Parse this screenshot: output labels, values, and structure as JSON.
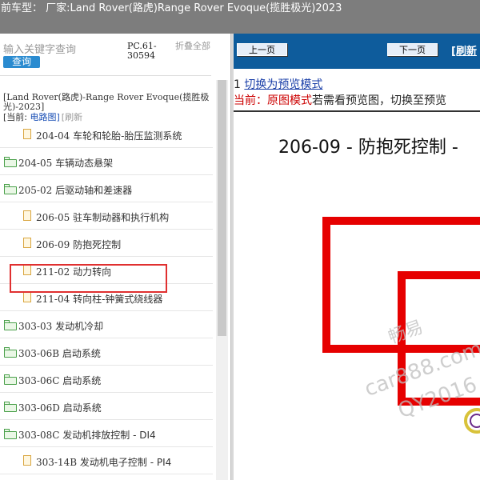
{
  "titlebar": {
    "text": "前车型： 厂家:Land Rover(路虎)Range Rover Evoque(揽胜极光)2023"
  },
  "sidebar": {
    "search_placeholder": "输入关键字查询",
    "query_button": "查询",
    "pc_code": "PC.61-30594",
    "collapse_all": "折叠全部",
    "vehicle_title": "[Land Rover(路虎)-Range Rover Evoque(揽胜极光)-2023]",
    "current_prefix": "[当前: ",
    "current_value": "电路图]",
    "refresh": "[刷新",
    "items": [
      {
        "code": "204-04",
        "label": "车轮和轮胎-胎压监测系统",
        "icon": "file-icon"
      },
      {
        "code": "204-05",
        "label": "车辆动态悬架",
        "icon": "folder-icon"
      },
      {
        "code": "205-02",
        "label": "后驱动轴和差速器",
        "icon": "folder-icon"
      },
      {
        "code": "206-05",
        "label": "驻车制动器和执行机构",
        "icon": "file-icon"
      },
      {
        "code": "206-09",
        "label": "防抱死控制",
        "icon": "file-icon"
      },
      {
        "code": "211-02",
        "label": "动力转向",
        "icon": "file-icon"
      },
      {
        "code": "211-04",
        "label": "转向柱-钟簧式绕线器",
        "icon": "file-icon"
      },
      {
        "code": "303-03",
        "label": "发动机冷却",
        "icon": "folder-icon"
      },
      {
        "code": "303-06B",
        "label": "启动系统",
        "icon": "folder-icon"
      },
      {
        "code": "303-06C",
        "label": "启动系统",
        "icon": "folder-icon"
      },
      {
        "code": "303-06D",
        "label": "启动系统",
        "icon": "folder-icon"
      },
      {
        "code": "303-08C",
        "label": "发动机排放控制 - DI4",
        "icon": "folder-icon"
      },
      {
        "code": "303-14B",
        "label": "发动机电子控制 - PI4",
        "icon": "file-icon"
      }
    ]
  },
  "viewer": {
    "prev_button": "上一页",
    "next_button": "下一页",
    "refresh_link": "[刷新",
    "mode_index": "1",
    "mode_link": "切换为预览模式",
    "mode_current_prefix": "当前：",
    "mode_current_value": "原图模式",
    "mode_hint": "若需看预览图，切换至预览",
    "doc_title": "206-09 - 防抱死控制 -",
    "watermark_line1": "畅易",
    "watermark_line2": "car888.com",
    "watermark_line3": "QY2016"
  },
  "colors": {
    "titlebar_bg": "#7d7d7d",
    "nav_bg": "#0e5c9c",
    "highlight": "#e03030",
    "diagram_red": "#e60000"
  }
}
